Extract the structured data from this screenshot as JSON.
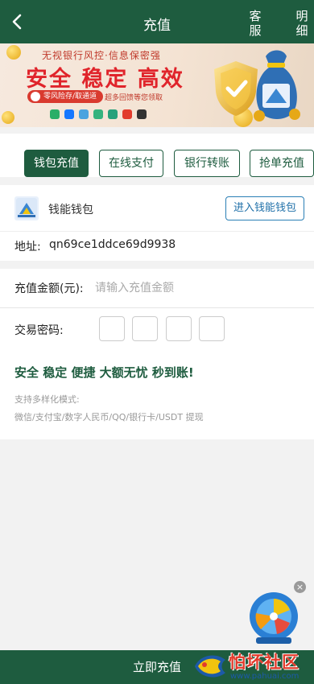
{
  "header": {
    "title": "充值",
    "service_label": "客服",
    "details_label": "明细"
  },
  "banner": {
    "subtitle": "无视银行风控·信息保密强",
    "headline": "安全 稳定 高效",
    "pill_text": "零风险存/取通道",
    "tagline": "超多回馈等您领取"
  },
  "tabs": [
    {
      "label": "钱包充值",
      "active": true
    },
    {
      "label": "在线支付",
      "active": false
    },
    {
      "label": "银行转账",
      "active": false
    },
    {
      "label": "抢单充值",
      "active": false
    }
  ],
  "wallet": {
    "name": "钱能钱包",
    "enter_label": "进入钱能钱包",
    "address_label": "地址:",
    "address_value": "qn69ce1ddce69d9938"
  },
  "form": {
    "amount_label": "充值金额(元):",
    "amount_placeholder": "请输入充值金额",
    "password_label": "交易密码:",
    "slogan": "安全 稳定 便捷 大额无忧 秒到账!",
    "modes_title": "支持多样化模式:",
    "modes_list": "微信/支付宝/数字人民币/QQ/银行卡/USDT 提现"
  },
  "submit_label": "立即充值",
  "watermark": {
    "text": "怕坏社区",
    "url": "www.pahuai.com"
  },
  "colors": {
    "primary": "#1e5c3f",
    "accent_red": "#e0242b",
    "link_blue": "#1e6fa8"
  }
}
